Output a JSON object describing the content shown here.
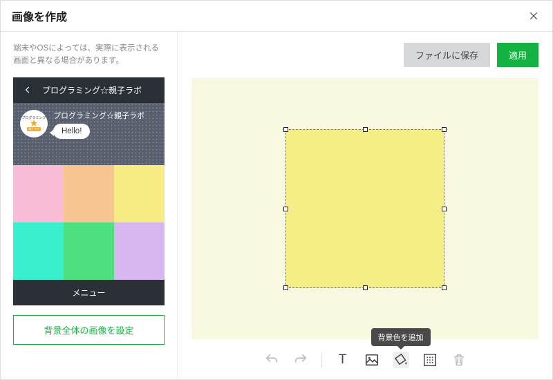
{
  "dialog": {
    "title": "画像を作成"
  },
  "disclaimer": "端末やOSによっては、実際に表示される画面と異なる場合があります。",
  "preview": {
    "title": "プログラミング☆親子ラボ",
    "chat_name": "プログラミング☆親子ラボ",
    "bubble": "Hello!",
    "avatar_top": "プログラミング",
    "avatar_bottom": "親子ラボ",
    "menu_label": "メニュー",
    "cells": [
      {
        "color": "#f8bcd6"
      },
      {
        "color": "#f7c58f"
      },
      {
        "color": "#f6ec83"
      },
      {
        "color": "#39efce"
      },
      {
        "color": "#4ee07e"
      },
      {
        "color": "#d7b6f2"
      }
    ]
  },
  "left": {
    "bg_button": "背景全体の画像を設定"
  },
  "actions": {
    "save": "ファイルに保存",
    "apply": "適用"
  },
  "canvas": {
    "bg": "#f8f7e0",
    "selection_color": "#f5ee87"
  },
  "toolbar": {
    "undo": "undo",
    "redo": "redo",
    "text": "T",
    "image": "image",
    "fill": "fill",
    "border": "border",
    "delete": "delete",
    "tooltip_fill": "背景色を追加"
  }
}
